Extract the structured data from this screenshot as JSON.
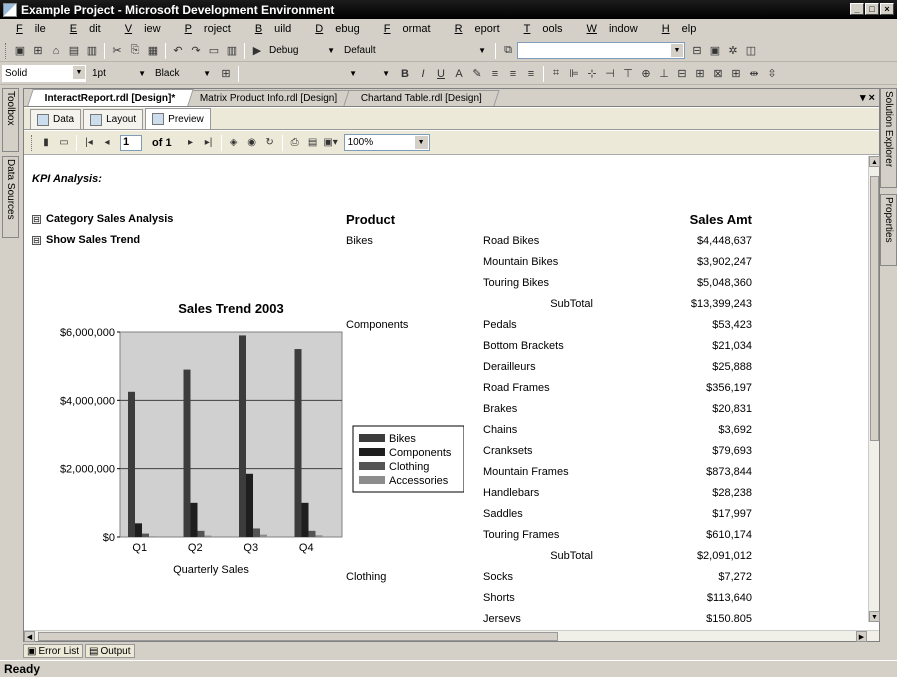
{
  "window": {
    "title": "Example Project - Microsoft Development Environment",
    "min": "_",
    "restore": "□",
    "close": "×"
  },
  "menu": [
    {
      "u": "F",
      "rest": "ile"
    },
    {
      "u": "E",
      "rest": "dit"
    },
    {
      "u": "V",
      "rest": "iew"
    },
    {
      "u": "P",
      "rest": "roject"
    },
    {
      "u": "B",
      "rest": "uild"
    },
    {
      "u": "D",
      "rest": "ebug"
    },
    {
      "u": "F",
      "rest": "ormat",
      "pre": ""
    },
    {
      "u": "R",
      "rest": "eport"
    },
    {
      "u": "T",
      "rest": "ools"
    },
    {
      "u": "W",
      "rest": "indow"
    },
    {
      "u": "H",
      "rest": "elp"
    }
  ],
  "toolbar1": {
    "config": "Debug",
    "platform": "Default"
  },
  "toolbar2": {
    "line_style": "Solid",
    "line_width": "1pt",
    "color": "Black"
  },
  "side": {
    "toolbox": "Toolbox",
    "data_sources": "Data Sources",
    "solution_explorer": "Solution Explorer",
    "properties": "Properties"
  },
  "doc_tabs": [
    "InteractReport.rdl [Design]*",
    "Matrix Product Info.rdl [Design]",
    "Chartand Table.rdl [Design]"
  ],
  "doc_controls": "▾ ×",
  "sub_tabs": [
    "Data",
    "Layout",
    "Preview"
  ],
  "report_toolbar": {
    "page": "1",
    "of": "of 1",
    "zoom": "100%"
  },
  "report": {
    "kpi_title": "KPI Analysis:",
    "toggle1": "Category Sales Analysis",
    "toggle2": "Show Sales Trend",
    "toggle_symbol": "⊟",
    "col_product": "Product",
    "col_sales": "Sales Amt",
    "categories": [
      {
        "name": "Bikes",
        "row": 0
      },
      {
        "name": "Components",
        "row": 4
      },
      {
        "name": "Clothing",
        "row": 16
      }
    ],
    "rows": [
      {
        "product": "Road Bikes",
        "amt": "$4,448,637"
      },
      {
        "product": "Mountain Bikes",
        "amt": "$3,902,247"
      },
      {
        "product": "Touring Bikes",
        "amt": "$5,048,360"
      },
      {
        "subtotal": "SubTotal",
        "amt": "$13,399,243"
      },
      {
        "product": "Pedals",
        "amt": "$53,423"
      },
      {
        "product": "Bottom Brackets",
        "amt": "$21,034"
      },
      {
        "product": "Derailleurs",
        "amt": "$25,888"
      },
      {
        "product": "Road Frames",
        "amt": "$356,197"
      },
      {
        "product": "Brakes",
        "amt": "$20,831"
      },
      {
        "product": "Chains",
        "amt": "$3,692"
      },
      {
        "product": "Cranksets",
        "amt": "$79,693"
      },
      {
        "product": "Mountain Frames",
        "amt": "$873,844"
      },
      {
        "product": "Handlebars",
        "amt": "$28,238"
      },
      {
        "product": "Saddles",
        "amt": "$17,997"
      },
      {
        "product": "Touring Frames",
        "amt": "$610,174"
      },
      {
        "subtotal": "SubTotal",
        "amt": "$2,091,012"
      },
      {
        "product": "Socks",
        "amt": "$7,272"
      },
      {
        "product": "Shorts",
        "amt": "$113,640"
      },
      {
        "product": "Jerseys",
        "amt": "$150,805"
      }
    ]
  },
  "chart_data": {
    "type": "bar",
    "title": "Sales Trend 2003",
    "xlabel": "Quarterly Sales",
    "ylabel": "",
    "categories": [
      "Q1",
      "Q2",
      "Q3",
      "Q4"
    ],
    "ylim": [
      0,
      6000000
    ],
    "yticks": [
      0,
      2000000,
      4000000,
      6000000
    ],
    "ytick_labels": [
      "$0",
      "$2,000,000",
      "$4,000,000",
      "$6,000,000"
    ],
    "grid": true,
    "legend": "right",
    "series": [
      {
        "name": "Bikes",
        "color": "#3c3c3c",
        "values": [
          4250000,
          4900000,
          5900000,
          5500000
        ]
      },
      {
        "name": "Components",
        "color": "#1e1e1e",
        "values": [
          400000,
          1000000,
          1850000,
          1000000
        ]
      },
      {
        "name": "Clothing",
        "color": "#555555",
        "values": [
          100000,
          180000,
          250000,
          180000
        ]
      },
      {
        "name": "Accessories",
        "color": "#8c8c8c",
        "values": [
          20000,
          40000,
          70000,
          50000
        ]
      }
    ]
  },
  "bottom_tabs": [
    "Error List",
    "Output"
  ],
  "status": "Ready"
}
